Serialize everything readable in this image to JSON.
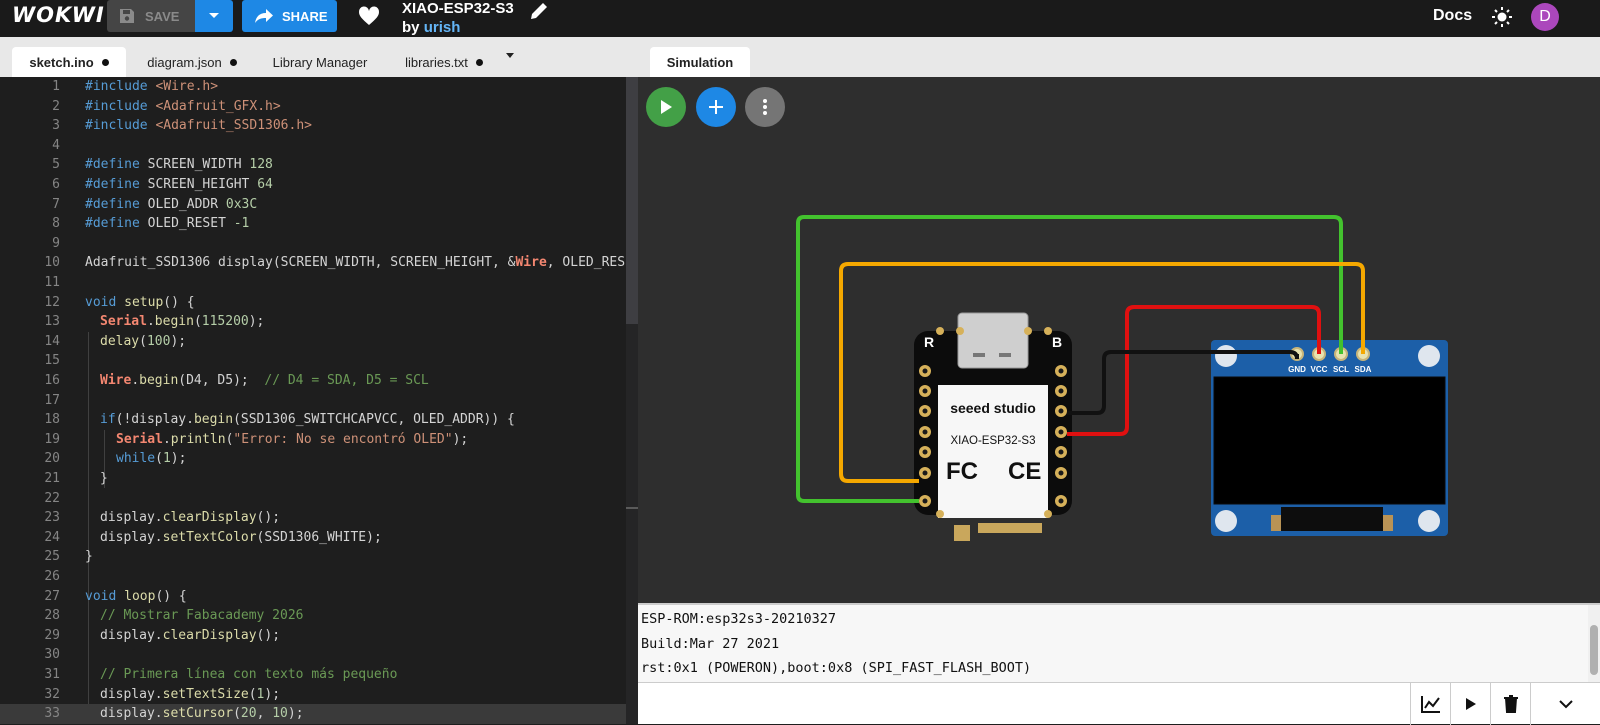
{
  "app": {
    "logo": "WOKWI"
  },
  "toolbar": {
    "save_label": "SAVE",
    "share_label": "SHARE"
  },
  "project": {
    "title": "XIAO-ESP32-S3",
    "by_prefix": "by ",
    "author": "urish"
  },
  "header": {
    "docs_label": "Docs",
    "avatar_letter": "D"
  },
  "editor": {
    "tabs": [
      {
        "label": "sketch.ino",
        "modified": true,
        "active": true
      },
      {
        "label": "diagram.json",
        "modified": true,
        "active": false
      },
      {
        "label": "Library Manager",
        "modified": false,
        "active": false
      },
      {
        "label": "libraries.txt",
        "modified": true,
        "active": false
      }
    ],
    "line_numbers": [
      "1",
      "2",
      "3",
      "4",
      "5",
      "6",
      "7",
      "8",
      "9",
      "10",
      "11",
      "12",
      "13",
      "14",
      "15",
      "16",
      "17",
      "18",
      "19",
      "20",
      "21",
      "22",
      "23",
      "24",
      "25",
      "26",
      "27",
      "28",
      "29",
      "30",
      "31",
      "32",
      "33"
    ]
  },
  "code": {
    "l1": [
      "#include ",
      "<Wire.h>"
    ],
    "l2": [
      "#include ",
      "<Adafruit_GFX.h>"
    ],
    "l3": [
      "#include ",
      "<Adafruit_SSD1306.h>"
    ],
    "l5": [
      "#define ",
      "SCREEN_WIDTH ",
      "128"
    ],
    "l6": [
      "#define ",
      "SCREEN_HEIGHT ",
      "64"
    ],
    "l7": [
      "#define ",
      "OLED_ADDR ",
      "0x3C"
    ],
    "l8": [
      "#define ",
      "OLED_RESET ",
      "-1"
    ],
    "l10": [
      "Adafruit_SSD1306 display(SCREEN_WIDTH, SCREEN_HEIGHT, &",
      "Wire",
      ", OLED_RESET"
    ],
    "l12": [
      "void ",
      "setup",
      "() {"
    ],
    "l13": [
      "Serial",
      ".",
      "begin",
      "(",
      "115200",
      ");"
    ],
    "l14": [
      "delay",
      "(",
      "100",
      ");"
    ],
    "l16": [
      "Wire",
      ".",
      "begin",
      "(D4, D5);  ",
      "// D4 = SDA, D5 = SCL"
    ],
    "l18": [
      "if",
      "(!display.",
      "begin",
      "(SSD1306_SWITCHCAPVCC, OLED_ADDR)) {"
    ],
    "l19": [
      "Serial",
      ".",
      "println",
      "(",
      "\"Error: No se encontró OLED\"",
      ");"
    ],
    "l20": [
      "while",
      "(",
      "1",
      ");"
    ],
    "l21": [
      "}"
    ],
    "l23": [
      "display.",
      "clearDisplay",
      "();"
    ],
    "l24": [
      "display.",
      "setTextColor",
      "(SSD1306_WHITE);"
    ],
    "l25": [
      "}"
    ],
    "l27": [
      "void ",
      "loop",
      "() {"
    ],
    "l28": [
      "// Mostrar Fabacademy 2026"
    ],
    "l29": [
      "display.",
      "clearDisplay",
      "();"
    ],
    "l31": [
      "// Primera línea con texto más pequeño"
    ],
    "l32": [
      "display.",
      "setTextSize",
      "(",
      "1",
      ");"
    ],
    "l33": [
      "display.",
      "setCursor",
      "(",
      "20",
      ", ",
      "10",
      ");"
    ]
  },
  "simulation": {
    "tab_label": "Simulation",
    "board": {
      "brand": "seeed studio",
      "model": "XIAO-ESP32-S3",
      "fc_mark": "FC",
      "ce_mark": "CE",
      "left_label": "R",
      "right_label": "B"
    },
    "oled": {
      "pins": [
        "GND",
        "VCC",
        "SCL",
        "SDA"
      ]
    },
    "wires": [
      {
        "color": "#43c22e",
        "name": "green-wire"
      },
      {
        "color": "#f5a800",
        "name": "orange-wire"
      },
      {
        "color": "#e01010",
        "name": "red-wire"
      },
      {
        "color": "#111111",
        "name": "black-wire"
      }
    ]
  },
  "console": {
    "lines": [
      "ESP-ROM:esp32s3-20210327",
      "Build:Mar 27 2021",
      "rst:0x1 (POWERON),boot:0x8 (SPI_FAST_FLASH_BOOT)"
    ]
  }
}
